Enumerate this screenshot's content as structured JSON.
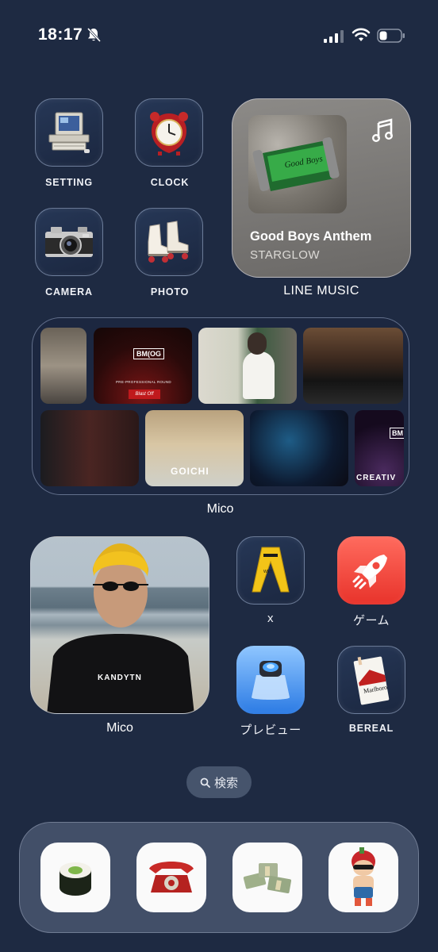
{
  "status_bar": {
    "time": "18:17"
  },
  "apps": {
    "setting": {
      "label": "SETTING"
    },
    "clock": {
      "label": "CLOCK"
    },
    "camera": {
      "label": "CAMERA"
    },
    "photo": {
      "label": "PHOTO"
    },
    "x": {
      "label": "x"
    },
    "game": {
      "label": "ゲーム"
    },
    "preview": {
      "label": "プレビュー"
    },
    "bereal": {
      "label": "BEREAL"
    }
  },
  "music_widget": {
    "song": "Good Boys Anthem",
    "artist": "STARGLOW",
    "label": "LINE MUSIC"
  },
  "photo_widget": {
    "label": "Mico",
    "tile_texts": {
      "bmog": "BM(OG",
      "round": "PRE-PROFESSIONAL ROUND",
      "blast": "Blast Off",
      "goichi": "GOICHI",
      "creative": "CREATIV",
      "bm2": "BM"
    }
  },
  "large_photo": {
    "label": "Mico",
    "shirt_text": "KANDYTN"
  },
  "search": {
    "label": "検索"
  },
  "dock": {
    "apps": [
      "sushi-roll",
      "red-telephone",
      "money-stacks",
      "character-figure"
    ]
  }
}
